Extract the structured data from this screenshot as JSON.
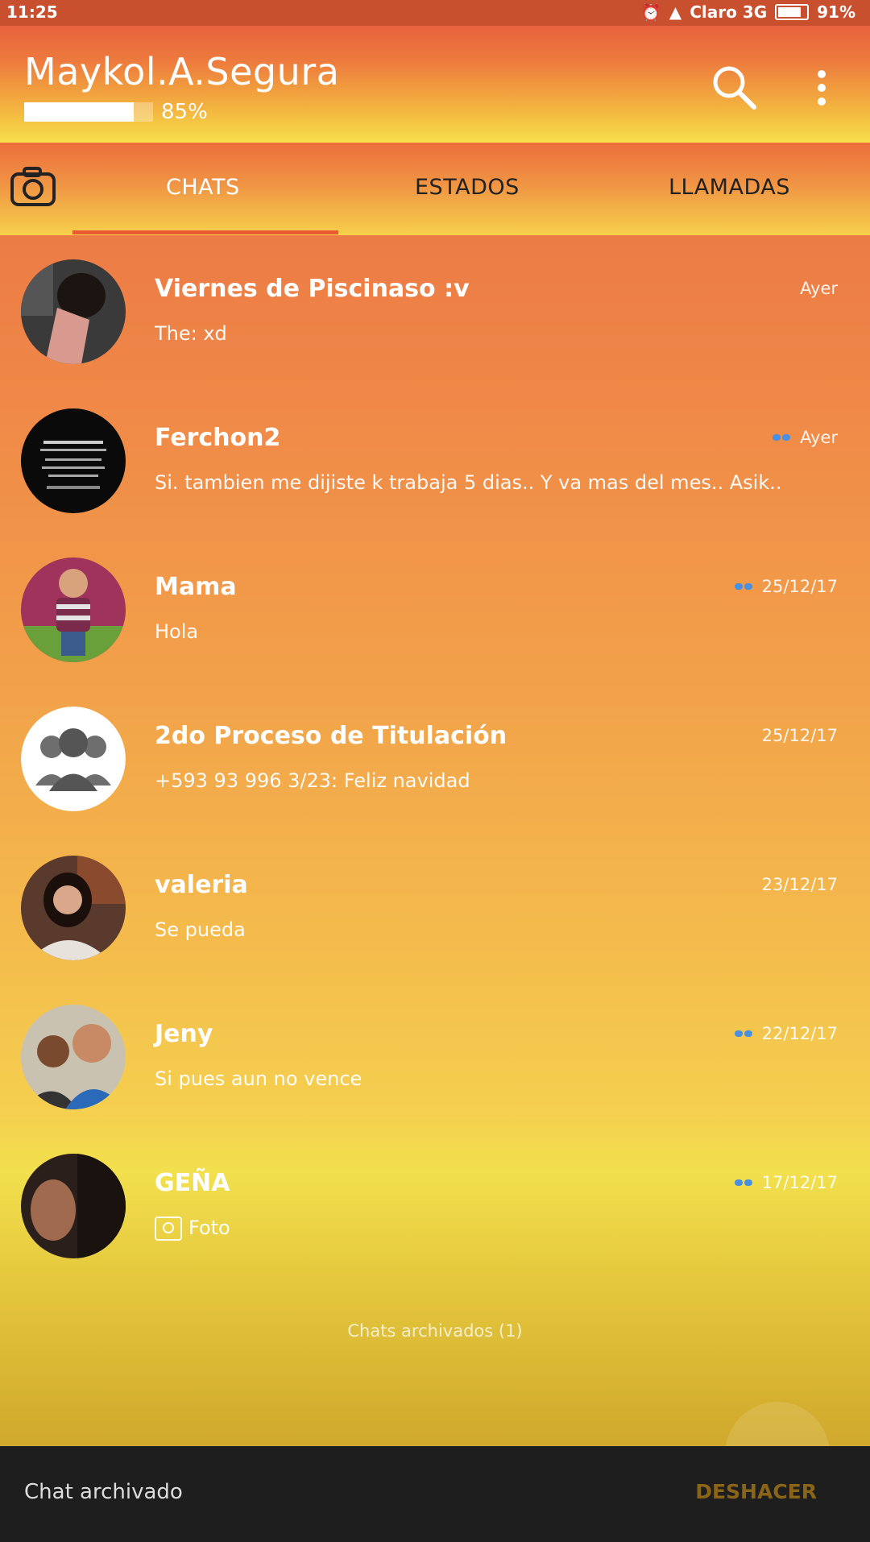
{
  "status_bar": {
    "time": "11:25",
    "carrier": "Claro 3G",
    "battery": "91%"
  },
  "app_bar": {
    "title": "Maykol.A.Segura",
    "progress_percent": 85,
    "progress_text": "85%",
    "icons": [
      "search-icon",
      "more-vert-icon"
    ]
  },
  "tabs": [
    {
      "label": "CHATS",
      "active": true
    },
    {
      "label": "ESTADOS",
      "active": false
    },
    {
      "label": "LLAMADAS",
      "active": false
    }
  ],
  "chats": [
    {
      "name": "Viernes de Piscinaso :v",
      "message": "The: xd",
      "time": "Ayer",
      "read_ticks": false,
      "avatar_color": "#3a3a3a"
    },
    {
      "name": "Ferchon2",
      "message": "Si. tambien me dijiste k trabaja 5 dias.. Y va mas del mes.. Asik..",
      "time": "Ayer",
      "read_ticks": true,
      "avatar_color": "#0a0a0a"
    },
    {
      "name": "Mama",
      "message": "Hola",
      "time": "25/12/17",
      "read_ticks": true,
      "avatar_color": "#a0335b"
    },
    {
      "name": "2do Proceso de Titulación",
      "message": "+593 93 996 3/23: Feliz navidad",
      "time": "25/12/17",
      "read_ticks": false,
      "avatar_color": "#ffffff"
    },
    {
      "name": "valeria",
      "message": "Se pueda",
      "time": "23/12/17",
      "read_ticks": false,
      "avatar_color": "#5b3a2e"
    },
    {
      "name": "Jeny",
      "message": "Si pues aun no vence",
      "time": "22/12/17",
      "read_ticks": true,
      "avatar_color": "#3b6fb0"
    },
    {
      "name": "GEÑA",
      "message": "Foto",
      "time": "17/12/17",
      "read_ticks": true,
      "avatar_color": "#2a1f1a"
    }
  ],
  "archived_label": "Chats archivados (1)",
  "snackbar": {
    "text": "Chat archivado",
    "action": "DESHACER"
  },
  "colors": {
    "accent": "#ea5b31",
    "ticks": "#4a90e2",
    "snackbar_action": "#8a6417"
  }
}
